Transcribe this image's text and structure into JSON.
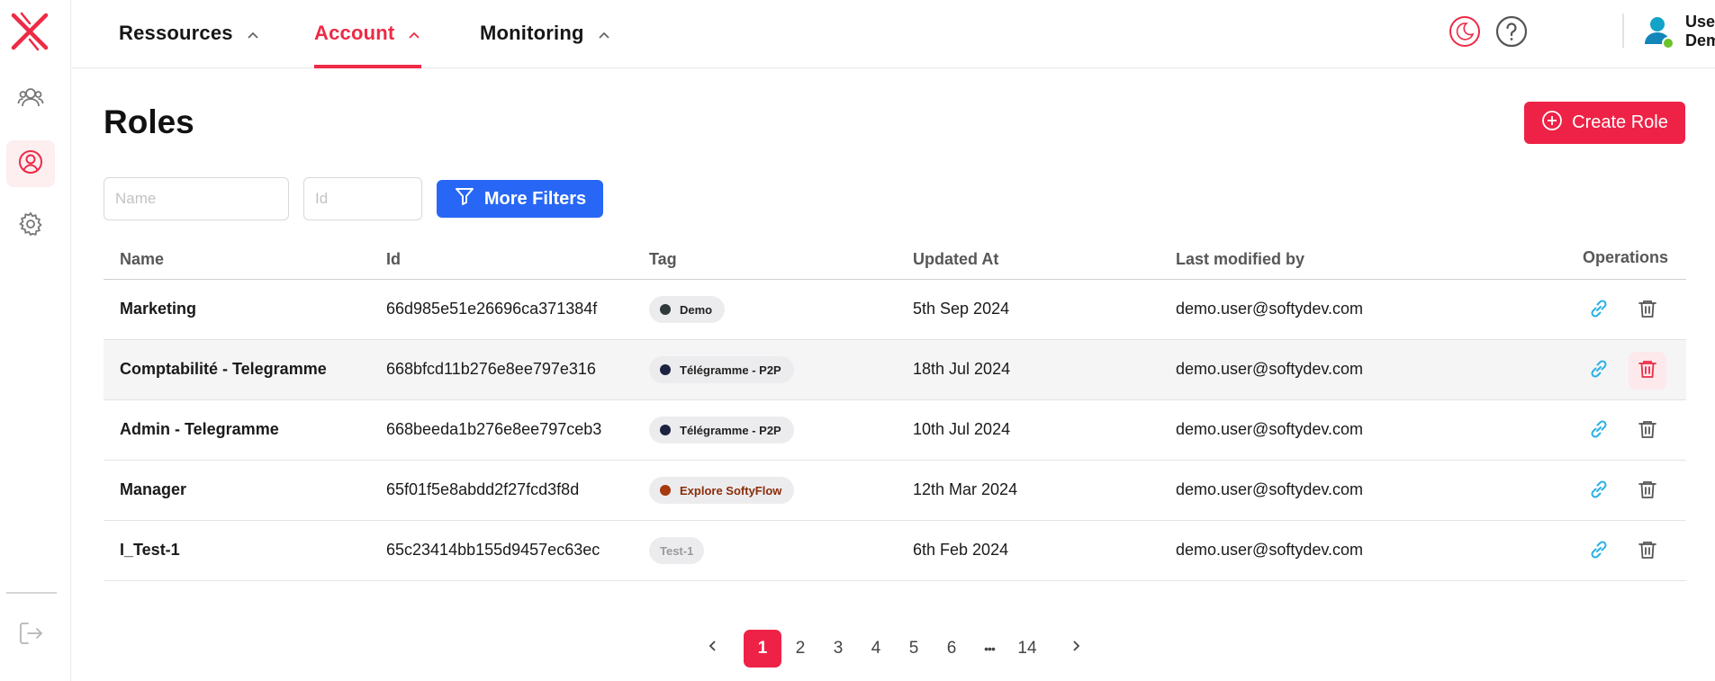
{
  "colors": {
    "accent": "#ee2246",
    "primary_blue": "#2867f5",
    "link_icon": "#29b1e6"
  },
  "sidebar": {
    "logo": "softydev-x-logo",
    "items": [
      {
        "icon": "users-icon",
        "active": false
      },
      {
        "icon": "user-circle-icon",
        "active": true
      },
      {
        "icon": "gear-icon",
        "active": false
      }
    ],
    "logout_icon": "logout-icon"
  },
  "nav": {
    "tabs": [
      {
        "label": "Ressources",
        "active": false
      },
      {
        "label": "Account",
        "active": true
      },
      {
        "label": "Monitoring",
        "active": false
      }
    ]
  },
  "header": {
    "theme_icon": "moon-sun-icon",
    "help_icon": "help-icon",
    "user_name": "User Demo",
    "user_status": "online"
  },
  "page": {
    "title": "Roles",
    "create_label": "Create Role"
  },
  "filters": {
    "name_placeholder": "Name",
    "id_placeholder": "Id",
    "more_label": "More Filters"
  },
  "table": {
    "columns": [
      "Name",
      "Id",
      "Tag",
      "Updated At",
      "Last modified by",
      "Operations"
    ],
    "rows": [
      {
        "name": "Marketing",
        "id": "66d985e51e26696ca371384f",
        "tag": "Demo",
        "tag_dot": "#2f3a3a",
        "tag_text_color": "#222222",
        "updated": "5th Sep 2024",
        "modified_by": "demo.user@softydev.com"
      },
      {
        "name": "Comptabilité - Telegramme",
        "id": "668bfcd11b276e8ee797e316",
        "tag": "Télégramme - P2P",
        "tag_dot": "#1b2340",
        "tag_text_color": "#222222",
        "updated": "18th Jul 2024",
        "modified_by": "demo.user@softydev.com"
      },
      {
        "name": "Admin - Telegramme",
        "id": "668beeda1b276e8ee797ceb3",
        "tag": "Télégramme - P2P",
        "tag_dot": "#1b2340",
        "tag_text_color": "#222222",
        "updated": "10th Jul 2024",
        "modified_by": "demo.user@softydev.com"
      },
      {
        "name": "Manager",
        "id": "65f01f5e8abdd2f27fcd3f8d",
        "tag": "Explore SoftyFlow",
        "tag_dot": "#a8380d",
        "tag_text_color": "#8a2c08",
        "updated": "12th Mar 2024",
        "modified_by": "demo.user@softydev.com"
      },
      {
        "name": "I_Test-1",
        "id": "65c23414bb155d9457ec63ec",
        "tag": "Test-1",
        "tag_dot": "",
        "tag_text_color": "#9a9a9e",
        "updated": "6th Feb 2024",
        "modified_by": "demo.user@softydev.com"
      }
    ]
  },
  "pagination": {
    "pages": [
      "1",
      "2",
      "3",
      "4",
      "5",
      "6",
      "•••",
      "14"
    ],
    "current": "1"
  }
}
